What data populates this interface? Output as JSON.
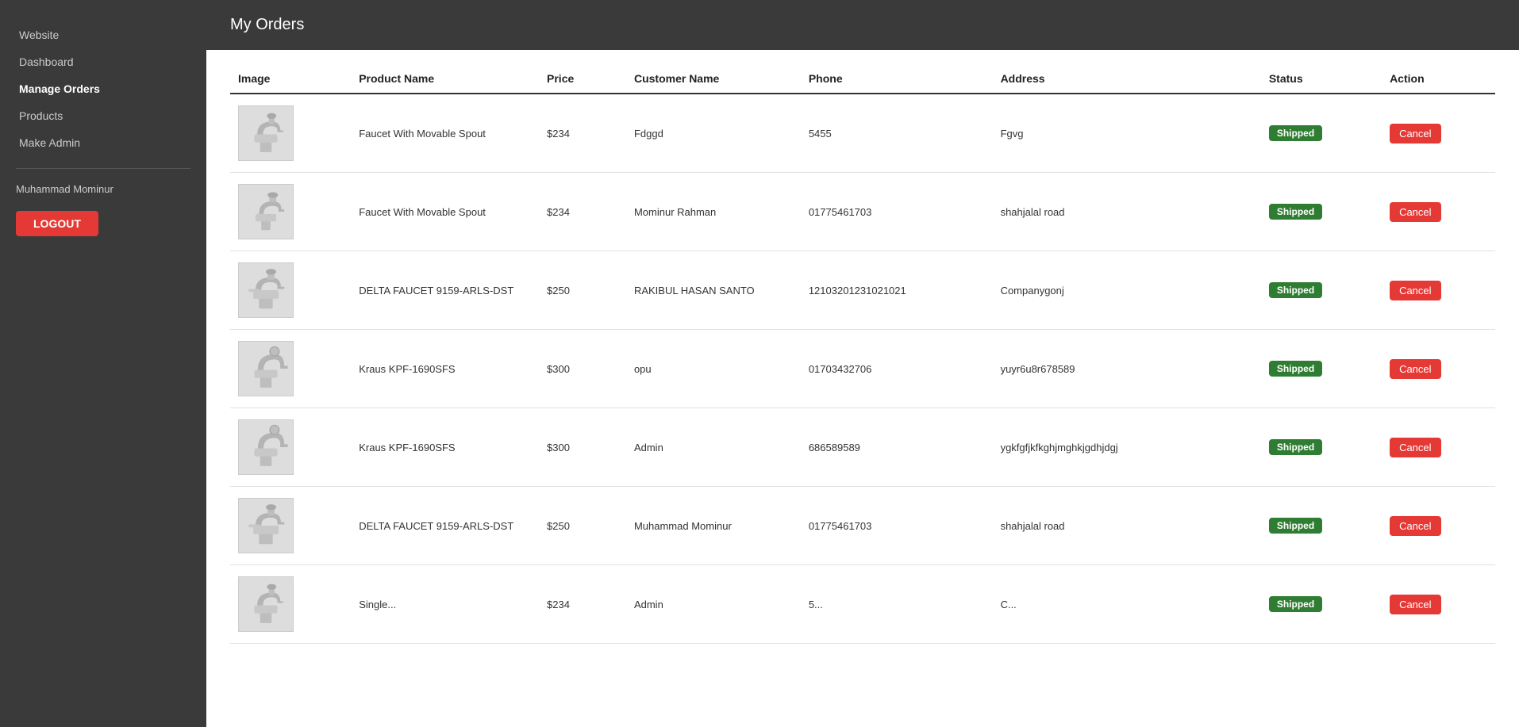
{
  "sidebar": {
    "nav_items": [
      {
        "label": "Website",
        "active": false,
        "name": "website"
      },
      {
        "label": "Dashboard",
        "active": false,
        "name": "dashboard"
      },
      {
        "label": "Manage Orders",
        "active": true,
        "name": "manage-orders"
      },
      {
        "label": "Products",
        "active": false,
        "name": "products"
      },
      {
        "label": "Make Admin",
        "active": false,
        "name": "make-admin"
      }
    ],
    "username": "Muhammad Mominur",
    "logout_label": "LOGOUT"
  },
  "page": {
    "title": "My Orders"
  },
  "table": {
    "headers": [
      "Image",
      "Product Name",
      "Price",
      "Customer Name",
      "Phone",
      "Address",
      "Status",
      "Action"
    ],
    "rows": [
      {
        "product_name": "Faucet With Movable Spout",
        "price": "$234",
        "customer_name": "Fdggd",
        "phone": "5455",
        "address": "Fgvg",
        "status": "Shipped",
        "action": "Cancel",
        "image_type": "faucet1"
      },
      {
        "product_name": "Faucet With Movable Spout",
        "price": "$234",
        "customer_name": "Mominur Rahman",
        "phone": "01775461703",
        "address": "shahjalal road",
        "status": "Shipped",
        "action": "Cancel",
        "image_type": "faucet2"
      },
      {
        "product_name": "DELTA FAUCET 9159-ARLS-DST",
        "price": "$250",
        "customer_name": "RAKIBUL HASAN SANTO",
        "phone": "12103201231021021",
        "address": "Companygonj",
        "status": "Shipped",
        "action": "Cancel",
        "image_type": "faucet3"
      },
      {
        "product_name": "Kraus KPF-1690SFS",
        "price": "$300",
        "customer_name": "opu",
        "phone": "01703432706",
        "address": "yuyr6u8r678589",
        "status": "Shipped",
        "action": "Cancel",
        "image_type": "faucet4"
      },
      {
        "product_name": "Kraus KPF-1690SFS",
        "price": "$300",
        "customer_name": "Admin",
        "phone": "686589589",
        "address": "ygkfgfjkfkghjmghkjgdhjdgj",
        "status": "Shipped",
        "action": "Cancel",
        "image_type": "faucet4"
      },
      {
        "product_name": "DELTA FAUCET 9159-ARLS-DST",
        "price": "$250",
        "customer_name": "Muhammad Mominur",
        "phone": "01775461703",
        "address": "shahjalal road",
        "status": "Shipped",
        "action": "Cancel",
        "image_type": "faucet3"
      },
      {
        "product_name": "Single...",
        "price": "$234",
        "customer_name": "Admin",
        "phone": "5...",
        "address": "C...",
        "status": "Shipped",
        "action": "Cancel",
        "image_type": "faucet1"
      }
    ]
  }
}
